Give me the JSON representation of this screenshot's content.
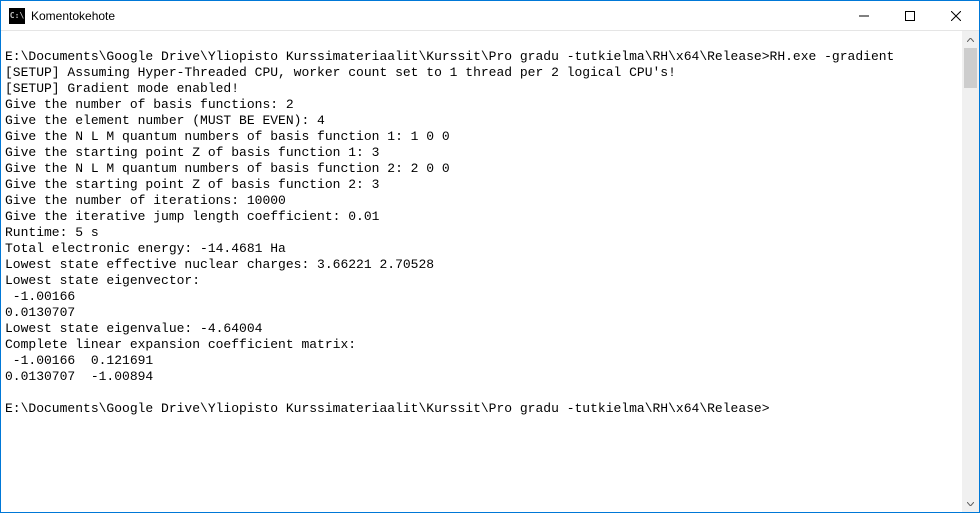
{
  "window": {
    "title": "Komentokehote",
    "icon_label": "C:\\"
  },
  "terminal": {
    "lines": [
      "",
      "E:\\Documents\\Google Drive\\Yliopisto Kurssimateriaalit\\Kurssit\\Pro gradu -tutkielma\\RH\\x64\\Release>RH.exe -gradient",
      "[SETUP] Assuming Hyper-Threaded CPU, worker count set to 1 thread per 2 logical CPU's!",
      "[SETUP] Gradient mode enabled!",
      "Give the number of basis functions: 2",
      "Give the element number (MUST BE EVEN): 4",
      "Give the N L M quantum numbers of basis function 1: 1 0 0",
      "Give the starting point Z of basis function 1: 3",
      "Give the N L M quantum numbers of basis function 2: 2 0 0",
      "Give the starting point Z of basis function 2: 3",
      "Give the number of iterations: 10000",
      "Give the iterative jump length coefficient: 0.01",
      "Runtime: 5 s",
      "Total electronic energy: -14.4681 Ha",
      "Lowest state effective nuclear charges: 3.66221 2.70528",
      "Lowest state eigenvector:",
      " -1.00166",
      "0.0130707",
      "Lowest state eigenvalue: -4.64004",
      "Complete linear expansion coefficient matrix:",
      " -1.00166  0.121691",
      "0.0130707  -1.00894",
      "",
      "E:\\Documents\\Google Drive\\Yliopisto Kurssimateriaalit\\Kurssit\\Pro gradu -tutkielma\\RH\\x64\\Release>"
    ]
  }
}
